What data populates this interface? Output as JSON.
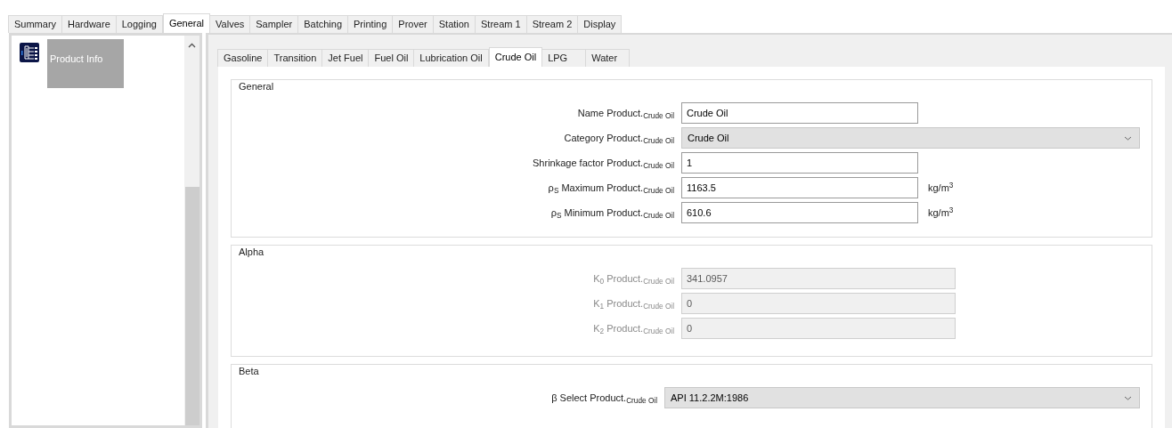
{
  "tabs": [
    {
      "label": "Summary",
      "selected": false
    },
    {
      "label": "Hardware",
      "selected": false
    },
    {
      "label": "Logging",
      "selected": false
    },
    {
      "label": "General",
      "selected": true
    },
    {
      "label": "Valves",
      "selected": false
    },
    {
      "label": "Sampler",
      "selected": false
    },
    {
      "label": "Batching",
      "selected": false
    },
    {
      "label": "Printing",
      "selected": false
    },
    {
      "label": "Prover",
      "selected": false
    },
    {
      "label": "Station",
      "selected": false
    },
    {
      "label": "Stream 1",
      "selected": false
    },
    {
      "label": "Stream 2",
      "selected": false
    },
    {
      "label": "Display",
      "selected": false
    }
  ],
  "sidebar": {
    "items": [
      {
        "label": "Product Info",
        "selected": true
      }
    ]
  },
  "product_tabs": [
    {
      "label": "Gasoline",
      "selected": false
    },
    {
      "label": "Transition",
      "selected": false
    },
    {
      "label": "Jet Fuel",
      "selected": false
    },
    {
      "label": "Fuel Oil",
      "selected": false
    },
    {
      "label": "Lubrication Oil",
      "selected": false
    },
    {
      "label": "Crude Oil",
      "selected": true
    },
    {
      "label": "LPG",
      "selected": false
    },
    {
      "label": "Water",
      "selected": false
    }
  ],
  "groups": [
    {
      "title": "General",
      "fields": [
        {
          "kind": "text",
          "label": "Name Product.$_{Crude Oil}$",
          "value": "Crude Oil",
          "disabled": false
        },
        {
          "kind": "dropdown",
          "label": "Category Product.$_{Crude Oil}$",
          "value": "Crude Oil"
        },
        {
          "kind": "text",
          "label": "Shrinkage factor Product.$_{Crude Oil}$",
          "value": "1",
          "disabled": false
        },
        {
          "kind": "text",
          "label": "ρ$_{S}$ Maximum Product.$_{Crude Oil}$",
          "value": "1163.5",
          "disabled": false,
          "unit": "kg/m$^{3}$"
        },
        {
          "kind": "text",
          "label": "ρ$_{S}$ Minimum Product.$_{Crude Oil}$",
          "value": "610.6",
          "disabled": false,
          "unit": "kg/m$^{3}$"
        }
      ]
    },
    {
      "title": "Alpha",
      "fields": [
        {
          "kind": "text",
          "label": "K$_{0}$ Product.$_{Crude Oil}$",
          "value": "341.0957",
          "disabled": true
        },
        {
          "kind": "text",
          "label": "K$_{1}$ Product.$_{Crude Oil}$",
          "value": "0",
          "disabled": true
        },
        {
          "kind": "text",
          "label": "K$_{2}$ Product.$_{Crude Oil}$",
          "value": "0",
          "disabled": true
        }
      ]
    },
    {
      "title": "Beta",
      "fields": [
        {
          "kind": "dropdown",
          "label": "β Select Product.$_{Crude Oil}$",
          "value": "API 11.2.2M:1986"
        }
      ]
    }
  ]
}
